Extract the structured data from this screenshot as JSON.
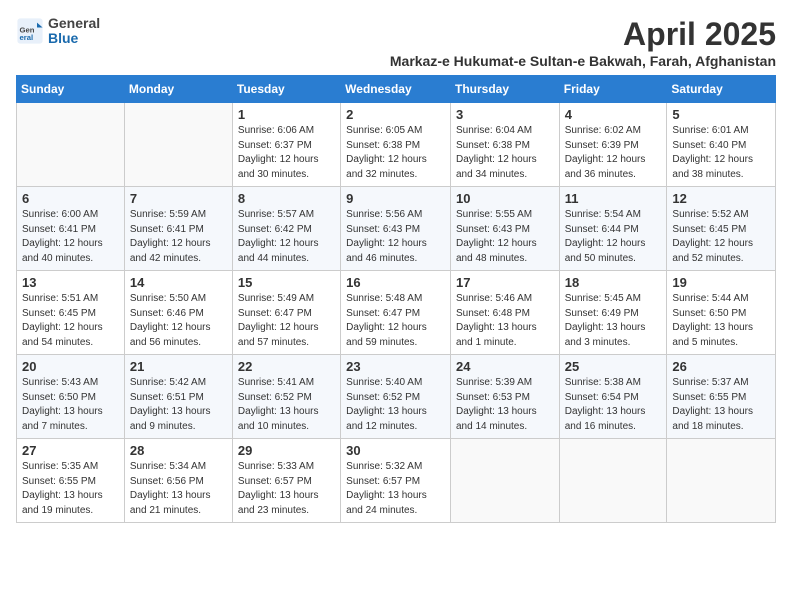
{
  "header": {
    "logo_general": "General",
    "logo_blue": "Blue",
    "month_title": "April 2025",
    "location": "Markaz-e Hukumat-e Sultan-e Bakwah, Farah, Afghanistan"
  },
  "days_of_week": [
    "Sunday",
    "Monday",
    "Tuesday",
    "Wednesday",
    "Thursday",
    "Friday",
    "Saturday"
  ],
  "weeks": [
    [
      {
        "day": "",
        "info": ""
      },
      {
        "day": "",
        "info": ""
      },
      {
        "day": "1",
        "info": "Sunrise: 6:06 AM\nSunset: 6:37 PM\nDaylight: 12 hours\nand 30 minutes."
      },
      {
        "day": "2",
        "info": "Sunrise: 6:05 AM\nSunset: 6:38 PM\nDaylight: 12 hours\nand 32 minutes."
      },
      {
        "day": "3",
        "info": "Sunrise: 6:04 AM\nSunset: 6:38 PM\nDaylight: 12 hours\nand 34 minutes."
      },
      {
        "day": "4",
        "info": "Sunrise: 6:02 AM\nSunset: 6:39 PM\nDaylight: 12 hours\nand 36 minutes."
      },
      {
        "day": "5",
        "info": "Sunrise: 6:01 AM\nSunset: 6:40 PM\nDaylight: 12 hours\nand 38 minutes."
      }
    ],
    [
      {
        "day": "6",
        "info": "Sunrise: 6:00 AM\nSunset: 6:41 PM\nDaylight: 12 hours\nand 40 minutes."
      },
      {
        "day": "7",
        "info": "Sunrise: 5:59 AM\nSunset: 6:41 PM\nDaylight: 12 hours\nand 42 minutes."
      },
      {
        "day": "8",
        "info": "Sunrise: 5:57 AM\nSunset: 6:42 PM\nDaylight: 12 hours\nand 44 minutes."
      },
      {
        "day": "9",
        "info": "Sunrise: 5:56 AM\nSunset: 6:43 PM\nDaylight: 12 hours\nand 46 minutes."
      },
      {
        "day": "10",
        "info": "Sunrise: 5:55 AM\nSunset: 6:43 PM\nDaylight: 12 hours\nand 48 minutes."
      },
      {
        "day": "11",
        "info": "Sunrise: 5:54 AM\nSunset: 6:44 PM\nDaylight: 12 hours\nand 50 minutes."
      },
      {
        "day": "12",
        "info": "Sunrise: 5:52 AM\nSunset: 6:45 PM\nDaylight: 12 hours\nand 52 minutes."
      }
    ],
    [
      {
        "day": "13",
        "info": "Sunrise: 5:51 AM\nSunset: 6:45 PM\nDaylight: 12 hours\nand 54 minutes."
      },
      {
        "day": "14",
        "info": "Sunrise: 5:50 AM\nSunset: 6:46 PM\nDaylight: 12 hours\nand 56 minutes."
      },
      {
        "day": "15",
        "info": "Sunrise: 5:49 AM\nSunset: 6:47 PM\nDaylight: 12 hours\nand 57 minutes."
      },
      {
        "day": "16",
        "info": "Sunrise: 5:48 AM\nSunset: 6:47 PM\nDaylight: 12 hours\nand 59 minutes."
      },
      {
        "day": "17",
        "info": "Sunrise: 5:46 AM\nSunset: 6:48 PM\nDaylight: 13 hours\nand 1 minute."
      },
      {
        "day": "18",
        "info": "Sunrise: 5:45 AM\nSunset: 6:49 PM\nDaylight: 13 hours\nand 3 minutes."
      },
      {
        "day": "19",
        "info": "Sunrise: 5:44 AM\nSunset: 6:50 PM\nDaylight: 13 hours\nand 5 minutes."
      }
    ],
    [
      {
        "day": "20",
        "info": "Sunrise: 5:43 AM\nSunset: 6:50 PM\nDaylight: 13 hours\nand 7 minutes."
      },
      {
        "day": "21",
        "info": "Sunrise: 5:42 AM\nSunset: 6:51 PM\nDaylight: 13 hours\nand 9 minutes."
      },
      {
        "day": "22",
        "info": "Sunrise: 5:41 AM\nSunset: 6:52 PM\nDaylight: 13 hours\nand 10 minutes."
      },
      {
        "day": "23",
        "info": "Sunrise: 5:40 AM\nSunset: 6:52 PM\nDaylight: 13 hours\nand 12 minutes."
      },
      {
        "day": "24",
        "info": "Sunrise: 5:39 AM\nSunset: 6:53 PM\nDaylight: 13 hours\nand 14 minutes."
      },
      {
        "day": "25",
        "info": "Sunrise: 5:38 AM\nSunset: 6:54 PM\nDaylight: 13 hours\nand 16 minutes."
      },
      {
        "day": "26",
        "info": "Sunrise: 5:37 AM\nSunset: 6:55 PM\nDaylight: 13 hours\nand 18 minutes."
      }
    ],
    [
      {
        "day": "27",
        "info": "Sunrise: 5:35 AM\nSunset: 6:55 PM\nDaylight: 13 hours\nand 19 minutes."
      },
      {
        "day": "28",
        "info": "Sunrise: 5:34 AM\nSunset: 6:56 PM\nDaylight: 13 hours\nand 21 minutes."
      },
      {
        "day": "29",
        "info": "Sunrise: 5:33 AM\nSunset: 6:57 PM\nDaylight: 13 hours\nand 23 minutes."
      },
      {
        "day": "30",
        "info": "Sunrise: 5:32 AM\nSunset: 6:57 PM\nDaylight: 13 hours\nand 24 minutes."
      },
      {
        "day": "",
        "info": ""
      },
      {
        "day": "",
        "info": ""
      },
      {
        "day": "",
        "info": ""
      }
    ]
  ]
}
